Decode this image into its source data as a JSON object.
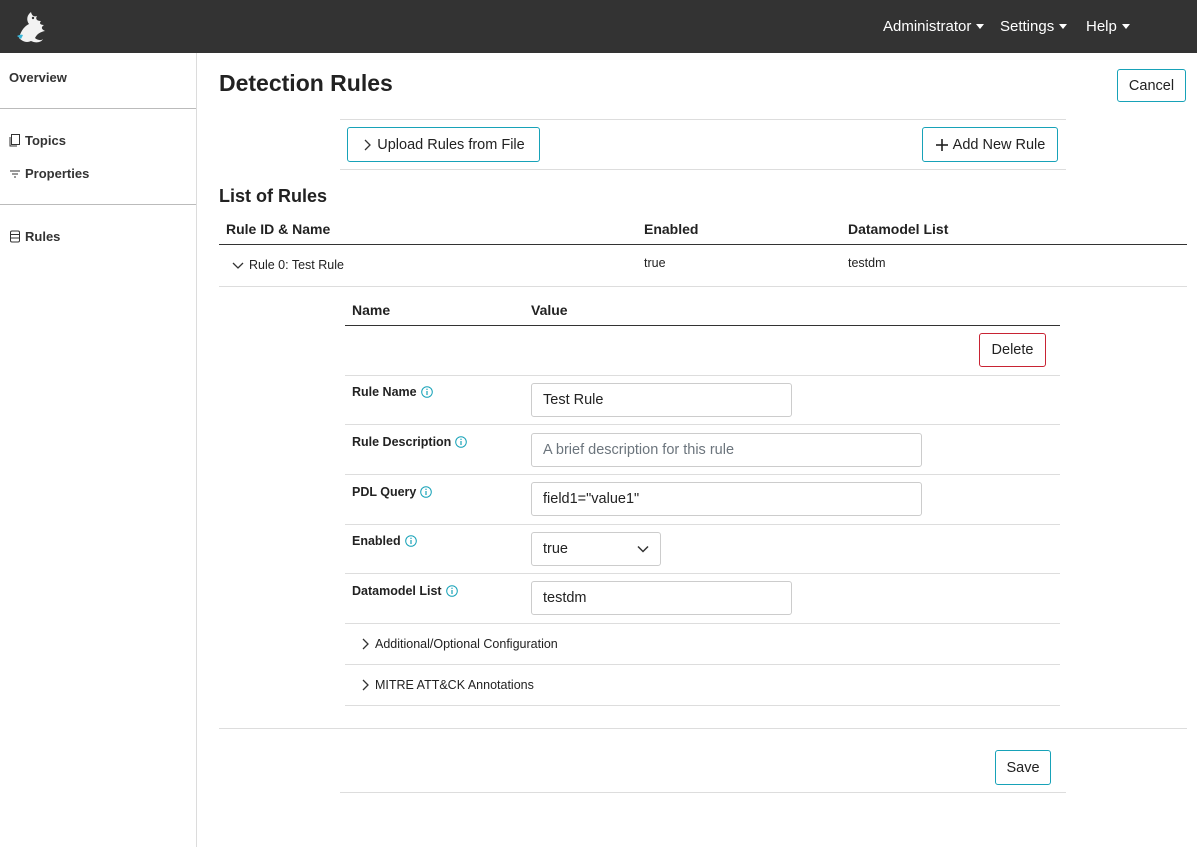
{
  "navbar": {
    "menus": [
      "Administrator",
      "Settings",
      "Help"
    ]
  },
  "sidebar": {
    "items": [
      {
        "label": "Overview",
        "icon": "none"
      },
      {
        "label": "Topics",
        "icon": "copy-icon"
      },
      {
        "label": "Properties",
        "icon": "filter-icon"
      },
      {
        "label": "Rules",
        "icon": "database-icon"
      }
    ]
  },
  "page": {
    "title": "Detection Rules",
    "cancel_label": "Cancel",
    "upload_label": "Upload Rules from File",
    "add_label": "Add New Rule",
    "list_title": "List of Rules",
    "save_label": "Save"
  },
  "rules_table": {
    "headers": [
      "Rule ID & Name",
      "Enabled",
      "Datamodel List"
    ],
    "rows": [
      {
        "name": "Rule 0: Test Rule",
        "enabled": "true",
        "datamodel": "testdm"
      }
    ]
  },
  "rule_detail": {
    "headers": [
      "Name",
      "Value"
    ],
    "delete_label": "Delete",
    "fields": {
      "rule_name": {
        "label": "Rule Name",
        "value": "Test Rule"
      },
      "rule_description": {
        "label": "Rule Description",
        "placeholder": "A brief description for this rule"
      },
      "pdl_query": {
        "label": "PDL Query",
        "value": "field1=\"value1\""
      },
      "enabled": {
        "label": "Enabled",
        "value": "true"
      },
      "datamodel_list": {
        "label": "Datamodel List",
        "value": "testdm"
      }
    },
    "expanders": [
      "Additional/Optional Configuration",
      "MITRE ATT&CK Annotations"
    ]
  },
  "colors": {
    "navbar": "#333333",
    "accent": "#17a2b8",
    "danger": "#c82333"
  }
}
